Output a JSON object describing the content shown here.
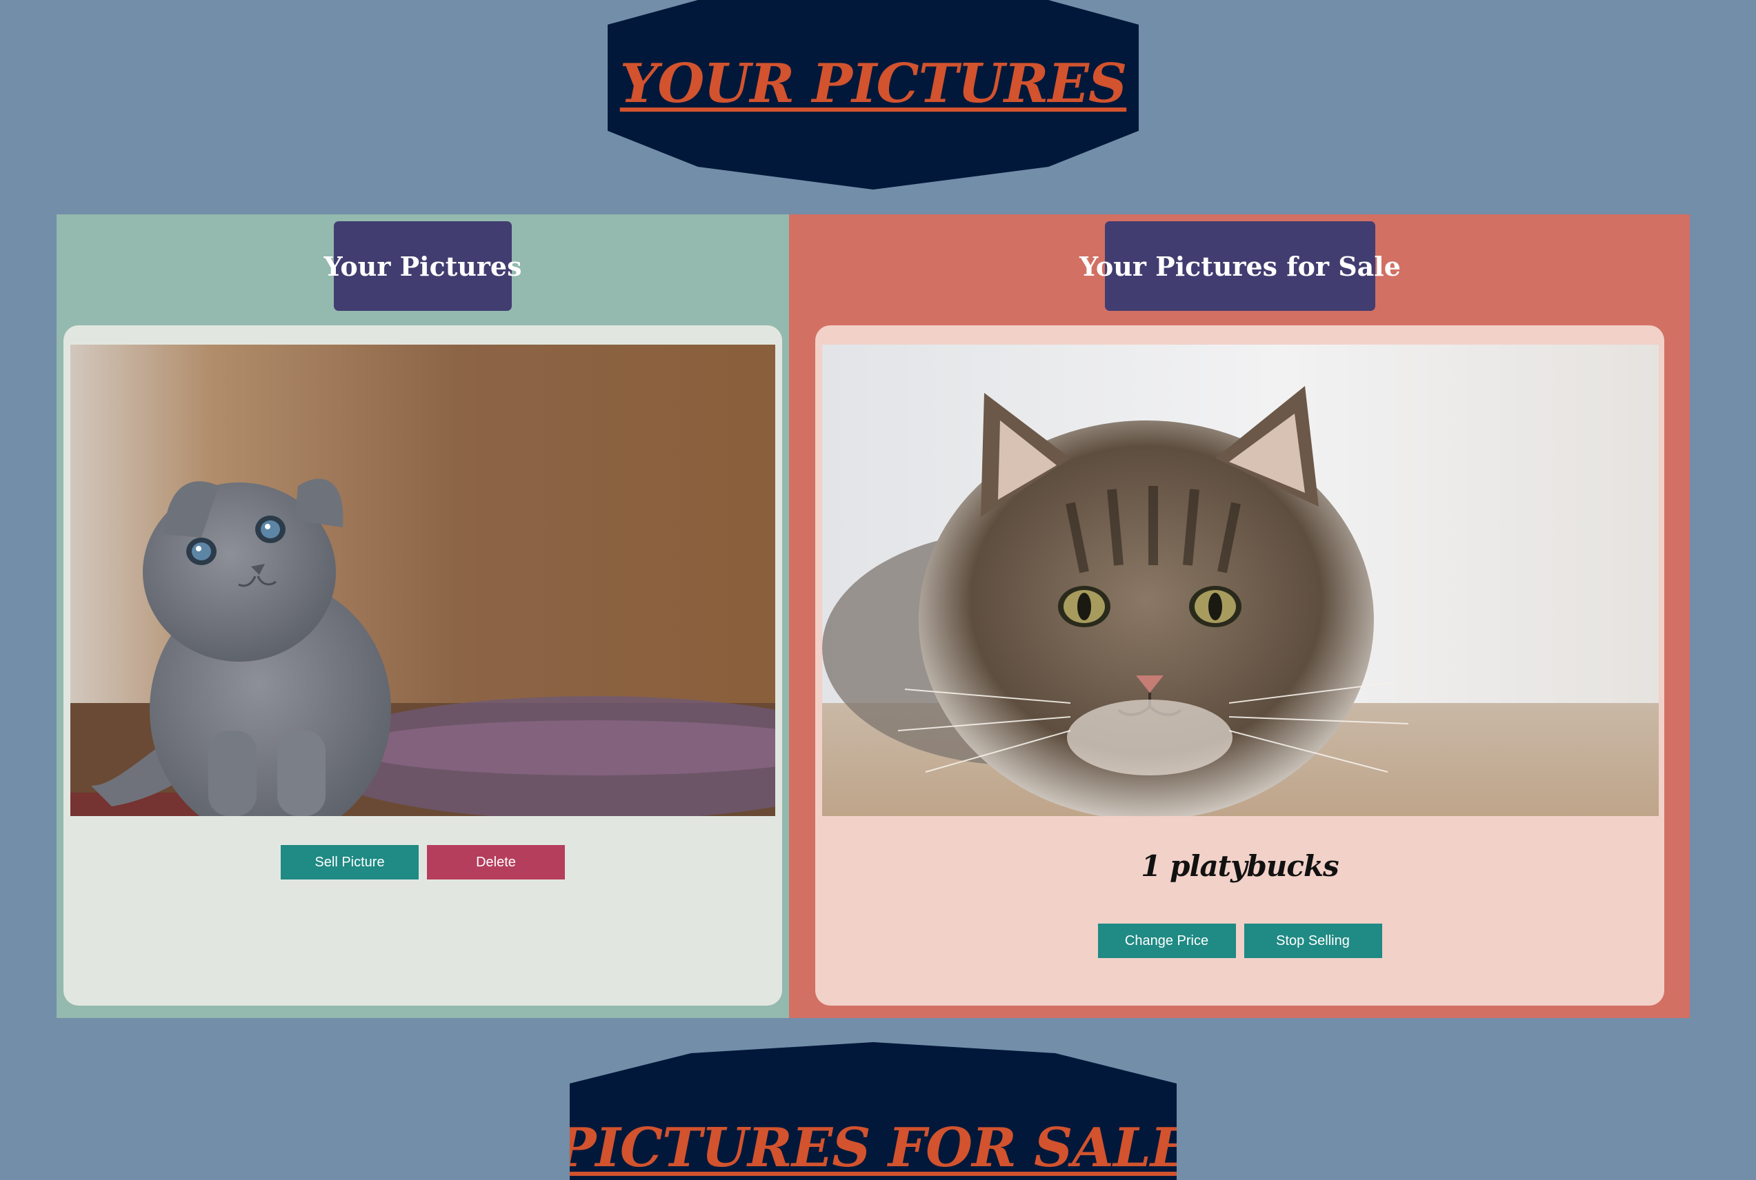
{
  "page": {
    "banner_title": "YOUR PICTURES",
    "footer_banner_title": "PICTURES FOR SALE"
  },
  "owned": {
    "header": "Your Pictures",
    "sell_label": "Sell Picture",
    "delete_label": "Delete"
  },
  "for_sale": {
    "header": "Your Pictures for Sale",
    "price": "1 platybucks",
    "change_price_label": "Change Price",
    "stop_selling_label": "Stop Selling"
  },
  "colors": {
    "page_background": "#728ea9",
    "banner": "#02183a",
    "banner_text": "#d2532e",
    "left_panel": "#94b9ae",
    "right_panel": "#d27064",
    "header_box": "#413d70",
    "teal_button": "#208a84",
    "red_button": "#b53e5d"
  }
}
